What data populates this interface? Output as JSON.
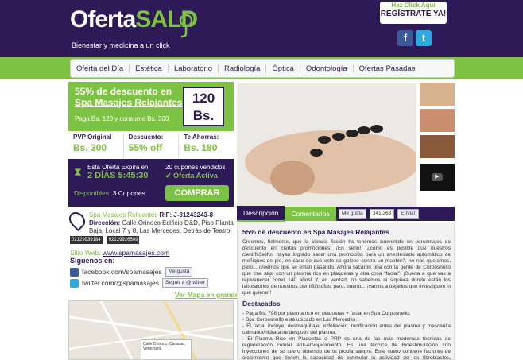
{
  "header": {
    "logo_white": "Oferta",
    "logo_green": "SAL",
    "logo_tail": "D",
    "tagline": "Bienestar y medicina a un click",
    "register_small": "Haz Click Aquí",
    "register_big": "REGÍSTRATE YA!",
    "facebook_icon_letter": "f",
    "twitter_icon_letter": "t"
  },
  "nav": {
    "items": [
      "Oferta del Día",
      "Estética",
      "Laboratorio",
      "Radiología",
      "Óptica",
      "Odontología",
      "Ofertas Pasadas"
    ]
  },
  "deal": {
    "line1": "55% de descuento en",
    "line2": "Spa Masajes Relajantes",
    "sub": "Paga Bs. 120 y consume Bs. 300",
    "price": "120 Bs."
  },
  "stats": [
    {
      "label": "PVP Original",
      "value": "Bs. 300"
    },
    {
      "label": "Descuento:",
      "value": "55% off"
    },
    {
      "label": "Te Ahorras:",
      "value": "Bs. 180"
    }
  ],
  "timer": {
    "expira": "Esta Oferta Expira en",
    "time": "2 DÍAS 5:45:30",
    "sold": "20 cupones vendidos",
    "active": "✔ Oferta Activa",
    "available_label": "Disponibles:",
    "available_value": "3 Cupones",
    "buy": "COMPRAR"
  },
  "business": {
    "name": "Spa Masajes Relajantes",
    "rif": "RIF: J-31243243-8",
    "address_label": "Dirección:",
    "address": "Calle Orinoco Edificio D&D, Piso Planta Baja, Local 7 y 8, Las Mercedes, Detrás de Teatro Bar.",
    "phone1": "02129939184",
    "phone2": "02129926509",
    "web_label": "Sitio Web:",
    "web": "www.spamasajes.com",
    "follow": "Siguenos en:",
    "facebook": "facebook.com/spamasajes",
    "facebook_btn": "Me gusta",
    "twitter": "twitter.com/@spamasajes",
    "twitter_btn": "Seguir a @twitter",
    "map_link": "Ver Mapa en grande",
    "map_bubble": "Calle Orinoco, Caracas, Venezuela"
  },
  "content": {
    "tab_desc": "Descripción",
    "tab_comments": "Comentarios",
    "like": "Me gusta",
    "like_count": "341.263",
    "send": "Enviar",
    "title": "55% de descuento en Spa Masajes Relajantes",
    "body": "Creemos, fielmente, que la ciencia ficción ha tenemos convertido en porcentajes de descuento en ciertas promociones. ¡En serio!, ¿cómo es posible que nuestros científilósofos hayan logrado sacar una promoción para un anestesiado automático de meñiques de pie, en caso de que este se golpee contra un mueble?, no nos quejamos, pero... creemos que se están pasando. Ahora sacaron una con la gente de Corposnello que trae algo con un plasma rico en plaquetas y otra cosa \"facial\". ¡Suena a que vas a rejuvenecer como 140 años! Y, en verdad, no sabemos ni siquiera donde están los laboratorios de nuestros científilósofos, pero, bueno... ¡vamos a dejarlos que investiguen lo que quieran!",
    "dest_title": "Destacados",
    "dest": [
      "- Paga Bs. 798 por plasma rico en plaquetas + facial en Spa Corposnello.",
      "- Spa Corposnello está ubicado en Las Mercedes.",
      "- El facial incluye: desmaquillaje, exfoliación, tonificación antes del plasma y mascarilla calmante/hidratante después del plasma.",
      "- El Plasma Rico en Plaquetas o PRP es una de las más modernas técnicas de regeneración celular anti-envejecimiento. Es una técnica de Bioestimulación con inyecciones de su suero obtenido de tu propia sangre. Este suero contiene factores de crecimiento que tienen la capacidad de estimular la actividad de los fibroblastos, encargados de fabricar colágeno y elastina, los dos máximos responsables de la elasticidad y juventud de la piel."
    ]
  }
}
